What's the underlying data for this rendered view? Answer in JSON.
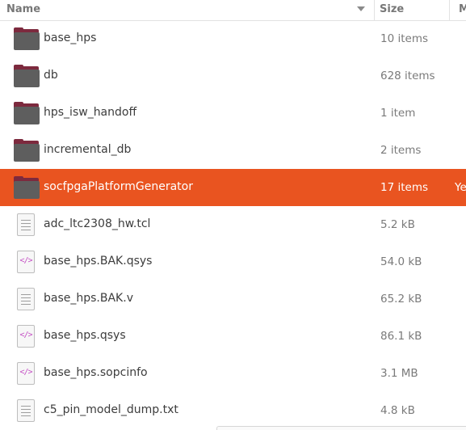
{
  "columns": {
    "name": "Name",
    "size": "Size",
    "modified": "M"
  },
  "colors": {
    "selection": "#e95420",
    "folder_front": "#5e5e5e",
    "folder_back": "#7d2a3e"
  },
  "files": [
    {
      "name": "base_hps",
      "size": "10 items",
      "type": "folder",
      "icon": "folder-icon"
    },
    {
      "name": "db",
      "size": "628 items",
      "type": "folder",
      "icon": "folder-icon"
    },
    {
      "name": "hps_isw_handoff",
      "size": "1 item",
      "type": "folder",
      "icon": "folder-icon"
    },
    {
      "name": "incremental_db",
      "size": "2 items",
      "type": "folder",
      "icon": "folder-icon"
    },
    {
      "name": "socfpgaPlatformGenerator",
      "size": "17 items",
      "modified": "Ye",
      "type": "folder",
      "icon": "folder-icon",
      "selected": true
    },
    {
      "name": "adc_ltc2308_hw.tcl",
      "size": "5.2 kB",
      "type": "text",
      "icon": "text-file-icon"
    },
    {
      "name": "base_hps.BAK.qsys",
      "size": "54.0 kB",
      "type": "code",
      "icon": "code-file-icon",
      "glyph": "</>"
    },
    {
      "name": "base_hps.BAK.v",
      "size": "65.2 kB",
      "type": "text",
      "icon": "text-file-icon"
    },
    {
      "name": "base_hps.qsys",
      "size": "86.1 kB",
      "type": "code",
      "icon": "code-file-icon",
      "glyph": "</>"
    },
    {
      "name": "base_hps.sopcinfo",
      "size": "3.1 MB",
      "type": "code",
      "icon": "code-file-icon",
      "glyph": "</>"
    },
    {
      "name": "c5_pin_model_dump.txt",
      "size": "4.8 kB",
      "type": "text",
      "icon": "text-file-icon"
    }
  ]
}
